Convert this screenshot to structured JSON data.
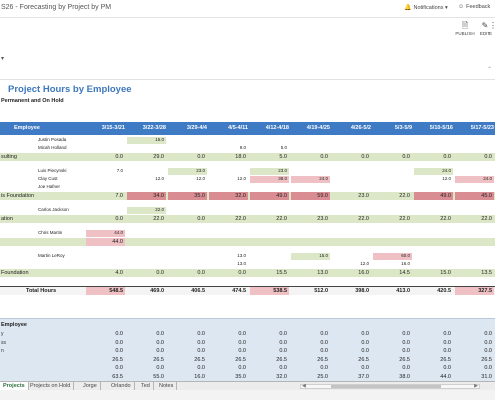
{
  "topbar": {
    "title": "S26 - Forecasting by Project by PM",
    "notifications_label": "Notifications",
    "feedback_label": "Feedback"
  },
  "ribbon": {
    "publish_label": "PUBLISH",
    "edit_label": "EDIT",
    "more_label": "E"
  },
  "heading": "Project Hours by Employee",
  "subheading": "Permanent and On Hold",
  "grid": {
    "employee_header": "Employee",
    "weeks": [
      "3/15-3/21",
      "3/22-3/28",
      "3/29-4/4",
      "4/5-4/11",
      "4/12-4/18",
      "4/19-4/25",
      "4/26-5/2",
      "5/3-5/9",
      "5/10-5/16",
      "5/17-5/23"
    ],
    "rows": [
      {
        "kind": "sub",
        "label": "Justin Posada",
        "cells": [
          "",
          "15.0",
          "",
          "",
          "",
          "",
          "",
          "",
          "",
          ""
        ],
        "colors": [
          "",
          "green",
          "",
          "",
          "",
          "",
          "",
          "",
          "",
          ""
        ]
      },
      {
        "kind": "sub",
        "label": "Micah Holland",
        "cells": [
          "",
          "",
          "",
          "9.0",
          "5.0",
          "",
          "",
          "",
          "",
          ""
        ],
        "colors": [
          "",
          "",
          "",
          "",
          "",
          "",
          "",
          "",
          "",
          ""
        ]
      },
      {
        "kind": "tot",
        "label": "sulting",
        "cells": [
          "0.0",
          "29.0",
          "0.0",
          "18.0",
          "5.0",
          "0.0",
          "0.0",
          "0.0",
          "0.0",
          "0.0"
        ],
        "colors": [
          "",
          "",
          "",
          "",
          "",
          "",
          "",
          "",
          "",
          ""
        ]
      },
      {
        "kind": "sub",
        "label": "Luis Piecynski",
        "cells": [
          "7.0",
          "",
          "23.0",
          "",
          "23.0",
          "",
          "",
          "",
          "24.0",
          ""
        ],
        "colors": [
          "",
          "",
          "green",
          "",
          "green",
          "",
          "",
          "",
          "green",
          ""
        ]
      },
      {
        "kind": "sub",
        "label": "Clay Cust",
        "cells": [
          "",
          "12.0",
          "12.0",
          "12.0",
          "38.0",
          "24.0",
          "",
          "",
          "12.0",
          "24.0"
        ],
        "colors": [
          "",
          "",
          "",
          "",
          "pink",
          "pink",
          "",
          "",
          "",
          "pink"
        ]
      },
      {
        "kind": "sub",
        "label": "Joe Hafner",
        "cells": [
          "",
          "",
          "",
          "",
          "",
          "",
          "",
          "",
          "",
          ""
        ],
        "colors": [
          "",
          "",
          "",
          "",
          "",
          "",
          "",
          "",
          "",
          ""
        ]
      },
      {
        "kind": "tot",
        "label": "is Foundation",
        "cells": [
          "7.0",
          "34.0",
          "35.0",
          "32.0",
          "49.0",
          "59.0",
          "23.0",
          "22.0",
          "49.0",
          "45.0"
        ],
        "colors": [
          "",
          "dark",
          "dark",
          "dark",
          "dark",
          "dark",
          "",
          "",
          "dark",
          "dark"
        ]
      },
      {
        "kind": "sub",
        "label": "Carlos Jackson",
        "cells": [
          "",
          "22.0",
          "",
          "",
          "",
          "",
          "",
          "",
          "",
          ""
        ],
        "colors": [
          "",
          "green",
          "",
          "",
          "",
          "",
          "",
          "",
          "",
          ""
        ]
      },
      {
        "kind": "tot",
        "label": "ation",
        "cells": [
          "0.0",
          "22.0",
          "0.0",
          "22.0",
          "22.0",
          "23.0",
          "22.0",
          "22.0",
          "22.0",
          "22.0"
        ],
        "colors": [
          "",
          "",
          "",
          "",
          "",
          "",
          "",
          "",
          "",
          ""
        ]
      },
      {
        "kind": "sub",
        "label": "Chris Martin",
        "cells": [
          "44.0",
          "",
          "",
          "",
          "",
          "",
          "",
          "",
          "",
          ""
        ],
        "colors": [
          "pink",
          "",
          "",
          "",
          "",
          "",
          "",
          "",
          "",
          ""
        ]
      },
      {
        "kind": "tot",
        "label": "",
        "cells": [
          "44.0",
          "",
          "",
          "",
          "",
          "",
          "",
          "",
          "",
          ""
        ],
        "colors": [
          "pink",
          "",
          "",
          "",
          "",
          "",
          "",
          "",
          "",
          ""
        ]
      },
      {
        "kind": "sub",
        "label": "Martin LeRoy",
        "cells": [
          "",
          "",
          "",
          "13.0",
          "",
          "15.0",
          "",
          "60.0",
          "",
          ""
        ],
        "colors": [
          "",
          "",
          "",
          "",
          "",
          "green",
          "",
          "pink",
          "",
          ""
        ]
      },
      {
        "kind": "sub",
        "label": "",
        "cells": [
          "",
          "",
          "",
          "13.0",
          "",
          "",
          "12.0",
          "16.0",
          "",
          ""
        ],
        "colors": [
          "",
          "",
          "",
          "",
          "",
          "",
          "",
          "",
          "",
          ""
        ]
      },
      {
        "kind": "tot",
        "label": "Foundation",
        "cells": [
          "4.0",
          "0.0",
          "0.0",
          "0.0",
          "15.5",
          "13.0",
          "16.0",
          "14.5",
          "15.0",
          "13.5"
        ],
        "colors": [
          "",
          "",
          "",
          "",
          "",
          "",
          "",
          "",
          "",
          ""
        ]
      }
    ],
    "total": {
      "label": "Total Hours",
      "cells": [
        "548.5",
        "469.0",
        "406.5",
        "474.5",
        "538.5",
        "512.0",
        "398.0",
        "413.0",
        "420.5",
        "327.5"
      ]
    }
  },
  "summary": {
    "title": "Employee",
    "rows": [
      {
        "label": "y",
        "cells": [
          "0.0",
          "0.0",
          "0.0",
          "0.0",
          "0.0",
          "0.0",
          "0.0",
          "0.0",
          "0.0",
          "0.0"
        ]
      },
      {
        "label": "ss",
        "cells": [
          "0.0",
          "0.0",
          "0.0",
          "0.0",
          "0.0",
          "0.0",
          "0.0",
          "0.0",
          "0.0",
          "0.0"
        ]
      },
      {
        "label": "n",
        "cells": [
          "0.0",
          "0.0",
          "0.0",
          "0.0",
          "0.0",
          "0.0",
          "0.0",
          "0.0",
          "0.0",
          "0.0"
        ]
      },
      {
        "label": "",
        "cells": [
          "26.5",
          "26.5",
          "26.5",
          "26.5",
          "26.5",
          "26.5",
          "26.5",
          "26.5",
          "26.5",
          "26.5"
        ]
      },
      {
        "label": "",
        "cells": [
          "0.0",
          "0.0",
          "0.0",
          "0.0",
          "0.0",
          "0.0",
          "0.0",
          "0.0",
          "0.0",
          "0.0"
        ]
      },
      {
        "label": "",
        "cells": [
          "63.5",
          "55.0",
          "16.0",
          "35.0",
          "32.0",
          "25.0",
          "37.0",
          "38.0",
          "44.0",
          "31.0"
        ]
      }
    ]
  },
  "tabs": [
    "Projects",
    "Projects on Hold",
    "Jorge",
    "Orlando",
    "Ted",
    "Notes"
  ],
  "colors": {
    "header_blue": "#3f7ac4",
    "pink": "#efc1c4",
    "green": "#dbe7c7",
    "accent": "#3d77bd"
  }
}
